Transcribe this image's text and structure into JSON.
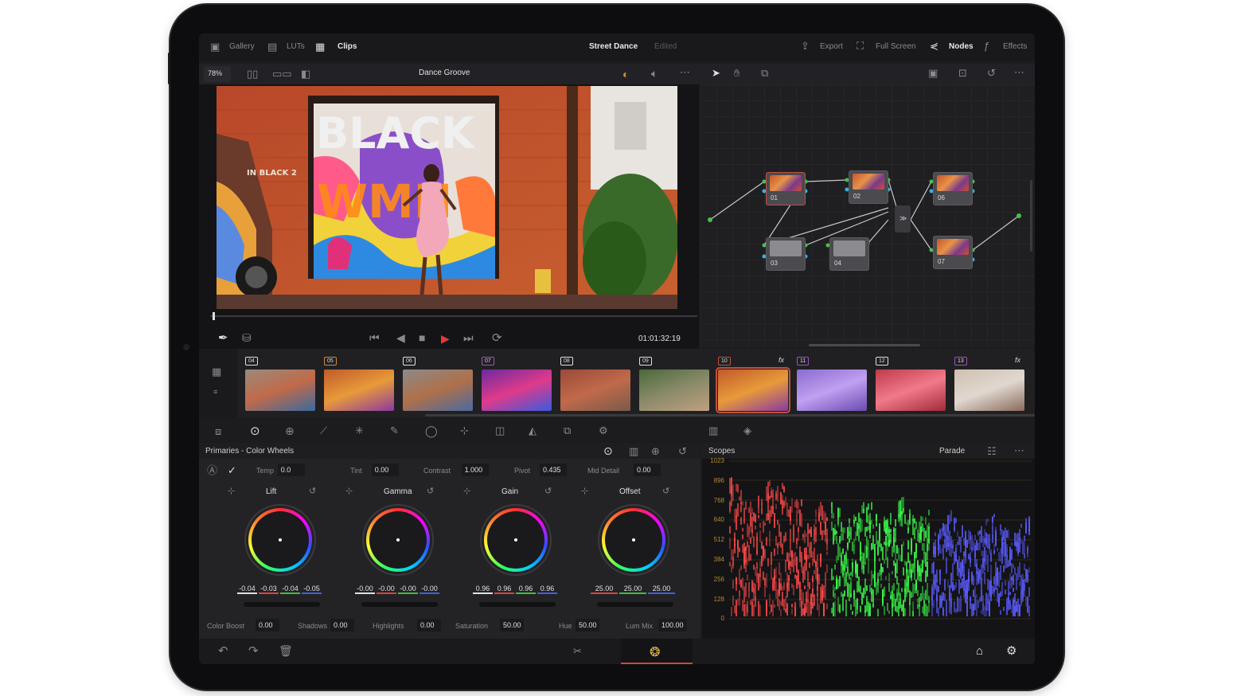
{
  "topbar": {
    "gallery": "Gallery",
    "luts": "LUTs",
    "clips": "Clips",
    "project_title": "Street Dance",
    "project_status": "Edited",
    "export": "Export",
    "full_screen": "Full Screen",
    "nodes": "Nodes",
    "effects": "Effects"
  },
  "viewer": {
    "zoom": "78%",
    "clip_title": "Dance Groove",
    "timecode": "01:01:32:19",
    "mural_text_1": "BLACK",
    "mural_text_2": "WMN",
    "shop_sign": "IN BLACK 2"
  },
  "nodes": [
    {
      "label": "01"
    },
    {
      "label": "02"
    },
    {
      "label": "03"
    },
    {
      "label": "04"
    },
    {
      "label": "06"
    },
    {
      "label": "07"
    }
  ],
  "clips": [
    {
      "num": "04",
      "color": "#e0e0e0",
      "fx": ""
    },
    {
      "num": "05",
      "color": "#d08a3a",
      "fx": ""
    },
    {
      "num": "06",
      "color": "#e0e0e0",
      "fx": ""
    },
    {
      "num": "07",
      "color": "#a050c0",
      "fx": ""
    },
    {
      "num": "08",
      "color": "#e0e0e0",
      "fx": ""
    },
    {
      "num": "09",
      "color": "#e0e0e0",
      "fx": ""
    },
    {
      "num": "10",
      "color": "#c44e3b",
      "fx": "fx"
    },
    {
      "num": "11",
      "color": "#a050c0",
      "fx": ""
    },
    {
      "num": "12",
      "color": "#e0e0e0",
      "fx": ""
    },
    {
      "num": "13",
      "color": "#a050c0",
      "fx": "fx"
    }
  ],
  "primaries": {
    "title": "Primaries - Color Wheels",
    "params_top": [
      {
        "label": "Temp",
        "value": "0.0"
      },
      {
        "label": "Tint",
        "value": "0.00"
      },
      {
        "label": "Contrast",
        "value": "1.000"
      },
      {
        "label": "Pivot",
        "value": "0.435"
      },
      {
        "label": "Mid Detail",
        "value": "0.00"
      }
    ],
    "wheels": [
      {
        "name": "Lift",
        "values": [
          "-0.04",
          "-0.03",
          "-0.04",
          "-0.05"
        ]
      },
      {
        "name": "Gamma",
        "values": [
          "-0.00",
          "-0.00",
          "-0.00",
          "-0.00"
        ]
      },
      {
        "name": "Gain",
        "values": [
          "0.96",
          "0.96",
          "0.96",
          "0.96"
        ]
      },
      {
        "name": "Offset",
        "values": [
          "25.00",
          "25.00",
          "25.00"
        ]
      }
    ],
    "params_bottom": [
      {
        "label": "Color Boost",
        "value": "0.00"
      },
      {
        "label": "Shadows",
        "value": "0.00"
      },
      {
        "label": "Highlights",
        "value": "0.00"
      },
      {
        "label": "Saturation",
        "value": "50.00"
      },
      {
        "label": "Hue",
        "value": "50.00"
      },
      {
        "label": "Lum Mix",
        "value": "100.00"
      }
    ]
  },
  "scopes": {
    "title": "Scopes",
    "mode": "Parade",
    "ticks": [
      "1023",
      "896",
      "768",
      "640",
      "512",
      "384",
      "256",
      "128",
      "0"
    ]
  },
  "colors": {
    "accent_red": "#c44e3b",
    "bg": "#1c1c1f"
  }
}
